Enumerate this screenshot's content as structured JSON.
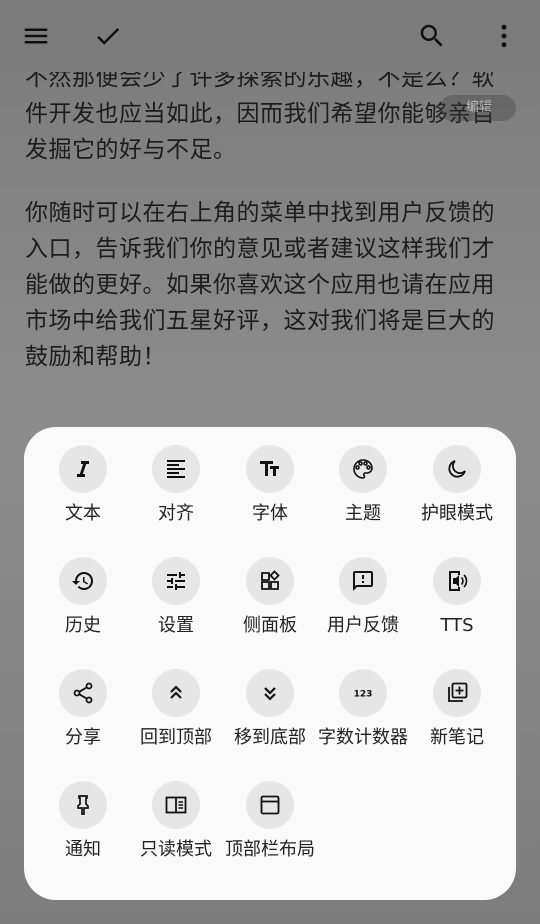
{
  "toolbar": {
    "menu_icon": "menu-icon",
    "check_icon": "check-icon",
    "search_icon": "search-icon",
    "more_icon": "more-vert-icon"
  },
  "editor": {
    "para1": "不然那便会少了许多探索的乐趣，不是么？软件开发也应当如此，因而我们希望你能够亲自发掘它的好与不足。",
    "para2": "你随时可以在右上角的菜单中找到用户反馈的入口，告诉我们你的意见或者建议这样我们才能做的更好。如果你喜欢这个应用也请在应用市场中给我们五星好评，这对我们将是巨大的鼓励和帮助！",
    "pill": "编辑"
  },
  "menu": {
    "items": [
      {
        "label": "文本",
        "icon": "italic-icon"
      },
      {
        "label": "对齐",
        "icon": "align-icon"
      },
      {
        "label": "字体",
        "icon": "text-size-icon"
      },
      {
        "label": "主题",
        "icon": "palette-icon"
      },
      {
        "label": "护眼模式",
        "icon": "moon-icon"
      },
      {
        "label": "历史",
        "icon": "history-icon"
      },
      {
        "label": "设置",
        "icon": "tune-icon"
      },
      {
        "label": "侧面板",
        "icon": "widgets-icon"
      },
      {
        "label": "用户反馈",
        "icon": "feedback-icon"
      },
      {
        "label": "TTS",
        "icon": "tts-icon"
      },
      {
        "label": "分享",
        "icon": "share-icon"
      },
      {
        "label": "回到顶部",
        "icon": "double-chevron-up-icon"
      },
      {
        "label": "移到底部",
        "icon": "double-chevron-down-icon"
      },
      {
        "label": "字数计数器",
        "icon": "counter-123-icon"
      },
      {
        "label": "新笔记",
        "icon": "new-note-icon"
      },
      {
        "label": "通知",
        "icon": "pin-icon"
      },
      {
        "label": "只读模式",
        "icon": "reader-icon"
      },
      {
        "label": "顶部栏布局",
        "icon": "toolbar-layout-icon"
      }
    ]
  }
}
